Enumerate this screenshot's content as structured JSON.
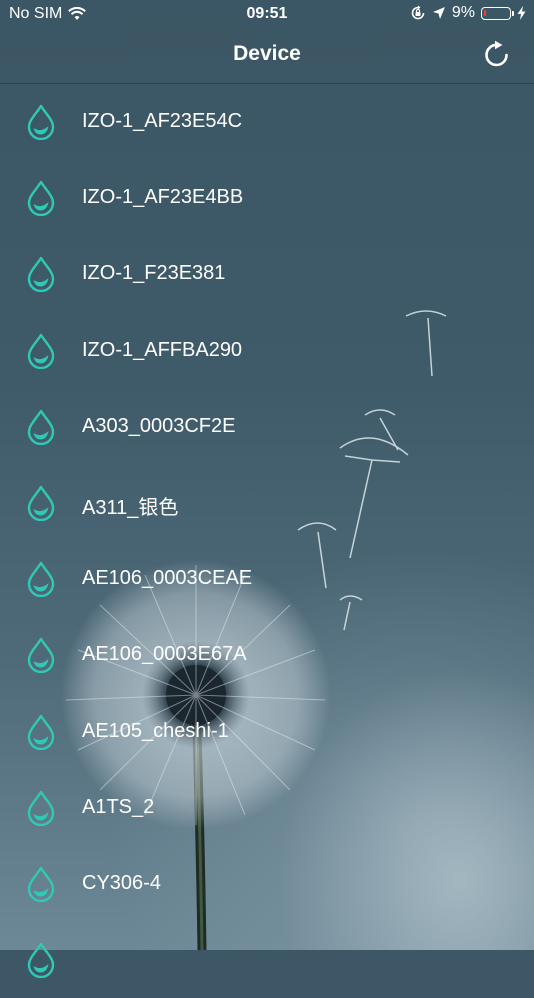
{
  "status_bar": {
    "carrier": "No SIM",
    "time": "09:51",
    "battery_percent": "9%",
    "battery_level": 0.09,
    "icons": [
      "wifi-icon",
      "orientation-lock-icon",
      "location-arrow-icon",
      "battery-icon",
      "charging-bolt-icon"
    ]
  },
  "nav": {
    "title": "Device",
    "refresh_icon": "refresh-icon"
  },
  "colors": {
    "accent": "#2fc9b4",
    "text": "#ffffff",
    "battery_low": "#ff3b30"
  },
  "devices": [
    {
      "name": "IZO-1_AF23E54C",
      "icon": "water-drop-icon"
    },
    {
      "name": "IZO-1_AF23E4BB",
      "icon": "water-drop-icon"
    },
    {
      "name": "IZO-1_F23E381",
      "icon": "water-drop-icon"
    },
    {
      "name": "IZO-1_AFFBA290",
      "icon": "water-drop-icon"
    },
    {
      "name": "A303_0003CF2E",
      "icon": "water-drop-icon"
    },
    {
      "name": "A311_银色",
      "icon": "water-drop-icon"
    },
    {
      "name": "AE106_0003CEAE",
      "icon": "water-drop-icon"
    },
    {
      "name": "AE106_0003E67A",
      "icon": "water-drop-icon"
    },
    {
      "name": "AE105_cheshi-1",
      "icon": "water-drop-icon"
    },
    {
      "name": "A1TS_2",
      "icon": "water-drop-icon"
    },
    {
      "name": "CY306-4",
      "icon": "water-drop-icon"
    },
    {
      "name": "",
      "icon": "water-drop-icon"
    }
  ]
}
